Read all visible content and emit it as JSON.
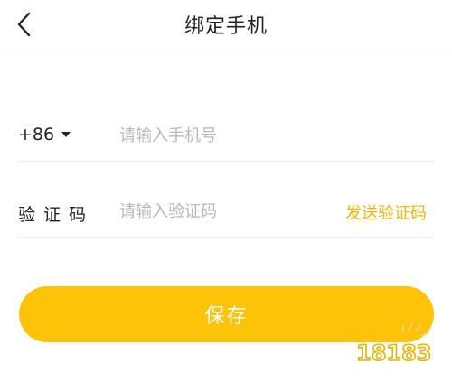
{
  "header": {
    "title": "绑定手机",
    "back_icon": "chevron-left-icon"
  },
  "phone_row": {
    "country_code": "+86",
    "dropdown_icon": "caret-down-icon",
    "placeholder": "请输入手机号",
    "value": ""
  },
  "code_row": {
    "label": "验证码",
    "placeholder": "请输入验证码",
    "value": "",
    "send_label": "发送验证码"
  },
  "save_button": {
    "label": "保存"
  },
  "watermark": {
    "text": "18183"
  },
  "colors": {
    "accent": "#fdc309",
    "link": "#f2b705",
    "text": "#222222",
    "placeholder": "#b7b7b7",
    "divider": "#ededed"
  }
}
